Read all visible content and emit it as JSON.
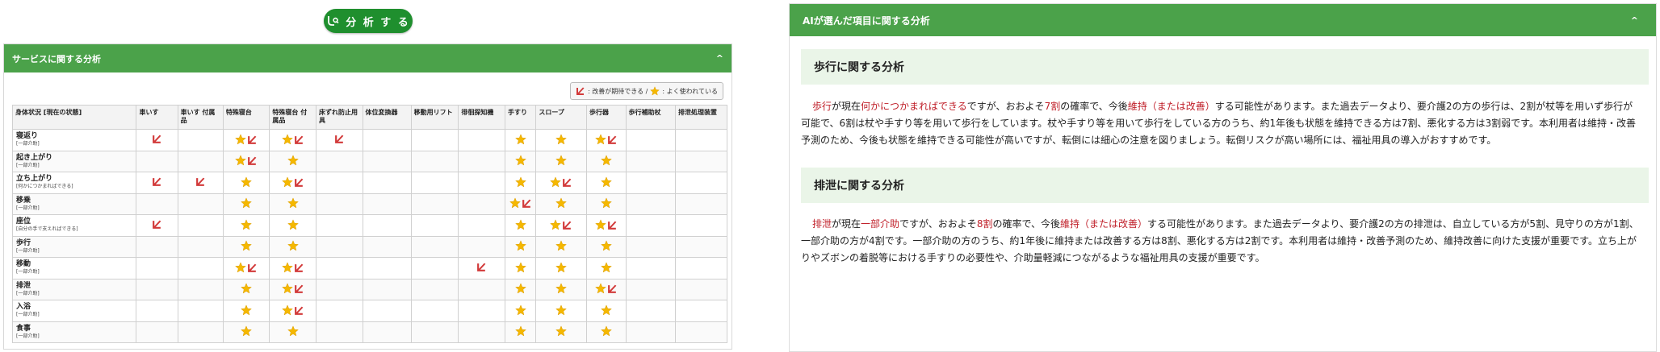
{
  "left": {
    "analyze_button": "分 析 す る",
    "panel_title": "サービスに関する分析",
    "legend": {
      "improve": ": 改善が期待できる /",
      "used": ": よく使われている"
    },
    "columns": [
      "身体状況 [現在の状態]",
      "車いす",
      "車いす 付属品",
      "特殊寝台",
      "特殊寝台 付属品",
      "床ずれ防止用具",
      "体位変換器",
      "移動用リフト",
      "徘徊探知機",
      "手すり",
      "スロープ",
      "歩行器",
      "歩行補助杖",
      "排泄処理装置"
    ],
    "rows": [
      {
        "name": "寝返り",
        "sub": "[一部介助]",
        "cells": [
          "R",
          "",
          "SR",
          "SR",
          "R",
          "",
          "",
          "",
          "S",
          "S",
          "SR",
          "",
          ""
        ]
      },
      {
        "name": "起き上がり",
        "sub": "[一部介助]",
        "cells": [
          "",
          "",
          "SR",
          "S",
          "",
          "",
          "",
          "",
          "S",
          "S",
          "S",
          "",
          ""
        ]
      },
      {
        "name": "立ち上がり",
        "sub": "[何かにつかまればできる]",
        "cells": [
          "R",
          "R",
          "S",
          "SR",
          "",
          "",
          "",
          "",
          "S",
          "SR",
          "S",
          "",
          ""
        ]
      },
      {
        "name": "移乗",
        "sub": "[一部介助]",
        "cells": [
          "",
          "",
          "S",
          "S",
          "",
          "",
          "",
          "",
          "SR",
          "S",
          "S",
          "",
          ""
        ]
      },
      {
        "name": "座位",
        "sub": "[自分の手で支えればできる]",
        "cells": [
          "R",
          "",
          "S",
          "S",
          "",
          "",
          "",
          "",
          "S",
          "SR",
          "SR",
          "",
          ""
        ]
      },
      {
        "name": "歩行",
        "sub": "[一部介助]",
        "cells": [
          "",
          "",
          "S",
          "S",
          "",
          "",
          "",
          "",
          "S",
          "S",
          "S",
          "",
          ""
        ]
      },
      {
        "name": "移動",
        "sub": "[一部介助]",
        "cells": [
          "",
          "",
          "SR",
          "SR",
          "",
          "",
          "",
          "R",
          "S",
          "S",
          "S",
          "",
          ""
        ]
      },
      {
        "name": "排泄",
        "sub": "[一部介助]",
        "cells": [
          "",
          "",
          "S",
          "SR",
          "",
          "",
          "",
          "",
          "S",
          "S",
          "SR",
          "",
          ""
        ]
      },
      {
        "name": "入浴",
        "sub": "[一部介助]",
        "cells": [
          "",
          "",
          "S",
          "SR",
          "",
          "",
          "",
          "",
          "S",
          "S",
          "S",
          "",
          ""
        ]
      },
      {
        "name": "食事",
        "sub": "[一部介助]",
        "cells": [
          "",
          "",
          "S",
          "S",
          "",
          "",
          "",
          "",
          "S",
          "S",
          "S",
          "",
          ""
        ]
      }
    ]
  },
  "right": {
    "panel_title": "AIが選んだ項目に関する分析",
    "sections": [
      {
        "title": "歩行に関する分析",
        "segments": [
          {
            "t": "歩行",
            "h": true
          },
          {
            "t": "が現在",
            "h": false
          },
          {
            "t": "何かにつかまればできる",
            "h": true
          },
          {
            "t": "ですが、おおよそ",
            "h": false
          },
          {
            "t": "7割",
            "h": true
          },
          {
            "t": "の確率で、今後",
            "h": false
          },
          {
            "t": "維持（または改善）",
            "h": true
          },
          {
            "t": "する可能性があります。また過去データより、要介護2の方の歩行は、2割が杖等を用いず歩行が可能で、6割は杖や手すり等を用いて歩行をしています。杖や手すり等を用いて歩行をしている方のうち、約1年後も状態を維持できる方は7割、悪化する方は3割弱です。本利用者は維持・改善予測のため、今後も状態を維持できる可能性が高いですが、転倒には細心の注意を図りましょう。転倒リスクが高い場所には、福祉用具の導入がおすすめです。",
            "h": false
          }
        ]
      },
      {
        "title": "排泄に関する分析",
        "segments": [
          {
            "t": "排泄",
            "h": true
          },
          {
            "t": "が現在",
            "h": false
          },
          {
            "t": "一部介助",
            "h": true
          },
          {
            "t": "ですが、おおよそ",
            "h": false
          },
          {
            "t": "8割",
            "h": true
          },
          {
            "t": "の確率で、今後",
            "h": false
          },
          {
            "t": "維持（または改善）",
            "h": true
          },
          {
            "t": "する可能性があります。また過去データより、要介護2の方の排泄は、自立している方が5割、見守りの方が1割、一部介助の方が4割です。一部介助の方のうち、約1年後に維持または改善する方は8割、悪化する方は2割です。本利用者は維持・改善予測のため、維持改善に向けた支援が重要です。立ち上がりやズボンの着脱等における手すりの必要性や、介助量軽減につながるような福祉用具の支援が重要です。",
            "h": false
          }
        ]
      }
    ]
  },
  "colors": {
    "green_header": "#4ba24a",
    "button_green": "#1f8f2e",
    "highlight_red": "#c0202a",
    "star": "#f5b800",
    "arrow": "#d23a3a"
  }
}
